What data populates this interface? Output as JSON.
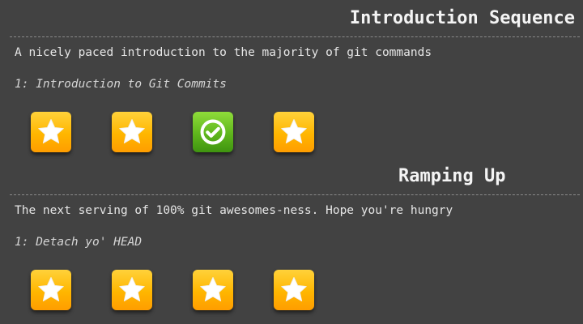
{
  "sequences": [
    {
      "title": "Introduction Sequence",
      "description": "A nicely paced introduction to the majority of git commands",
      "current_level": "1: Introduction to Git Commits",
      "levels": [
        {
          "state": "unsolved",
          "icon": "star-icon"
        },
        {
          "state": "unsolved",
          "icon": "star-icon"
        },
        {
          "state": "solved",
          "icon": "checkmark-icon"
        },
        {
          "state": "unsolved",
          "icon": "star-icon"
        }
      ]
    },
    {
      "title": "Ramping Up",
      "description": "The next serving of 100% git awesomes-ness. Hope you're hungry",
      "current_level": "1: Detach yo' HEAD",
      "levels": [
        {
          "state": "unsolved",
          "icon": "star-icon"
        },
        {
          "state": "unsolved",
          "icon": "star-icon"
        },
        {
          "state": "unsolved",
          "icon": "star-icon"
        },
        {
          "state": "unsolved",
          "icon": "star-icon"
        }
      ]
    }
  ],
  "colors": {
    "background": "#424242",
    "star_tile": "#ffb600",
    "solved_tile": "#5fb61c",
    "text": "#e8e8e8"
  }
}
